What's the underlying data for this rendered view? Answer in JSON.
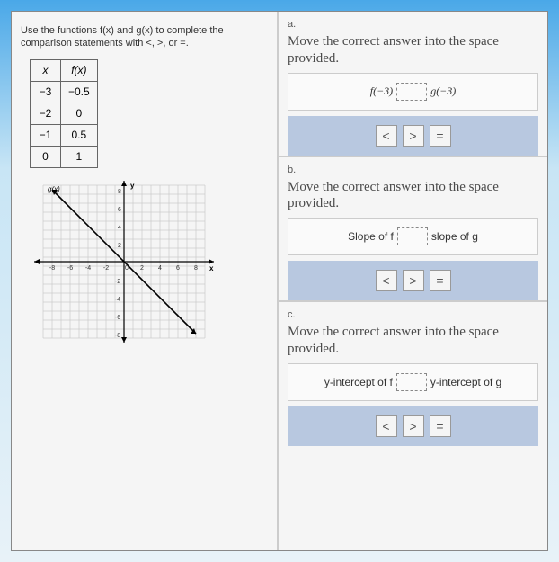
{
  "instructions": "Use the functions f(x) and g(x) to complete the comparison statements with <, >, or =.",
  "table": {
    "headers": {
      "x": "x",
      "fx": "f(x)"
    },
    "rows": [
      {
        "x": "−3",
        "fx": "−0.5"
      },
      {
        "x": "−2",
        "fx": "0"
      },
      {
        "x": "−1",
        "fx": "0.5"
      },
      {
        "x": "0",
        "fx": "1"
      }
    ]
  },
  "graph": {
    "label": "g(x)",
    "xlabel": "x",
    "ylabel": "y",
    "ticks": [
      "-8",
      "-6",
      "-4",
      "-2",
      "0",
      "2",
      "4",
      "6",
      "8"
    ]
  },
  "chart_data": {
    "type": "line",
    "title": "g(x)",
    "xlabel": "x",
    "ylabel": "y",
    "xlim": [
      -9,
      9
    ],
    "ylim": [
      -9,
      9
    ],
    "series": [
      {
        "name": "g(x)",
        "x": [
          -8,
          -6,
          -4,
          -2,
          0,
          2,
          4,
          6,
          8
        ],
        "values": [
          8,
          6,
          4,
          2,
          0,
          -2,
          -4,
          -6,
          -8
        ]
      }
    ]
  },
  "sections": {
    "a": {
      "label": "a.",
      "prompt": "Move the correct answer into the space provided.",
      "left": "f(−3)",
      "right": "g(−3)"
    },
    "b": {
      "label": "b.",
      "prompt": "Move the correct answer into the space provided.",
      "left": "Slope of f",
      "right": "slope of g"
    },
    "c": {
      "label": "c.",
      "prompt": "Move the correct answer into the space provided.",
      "left": "y-intercept of f",
      "right": "y-intercept of g"
    }
  },
  "choices": {
    "lt": "<",
    "gt": ">",
    "eq": "="
  }
}
